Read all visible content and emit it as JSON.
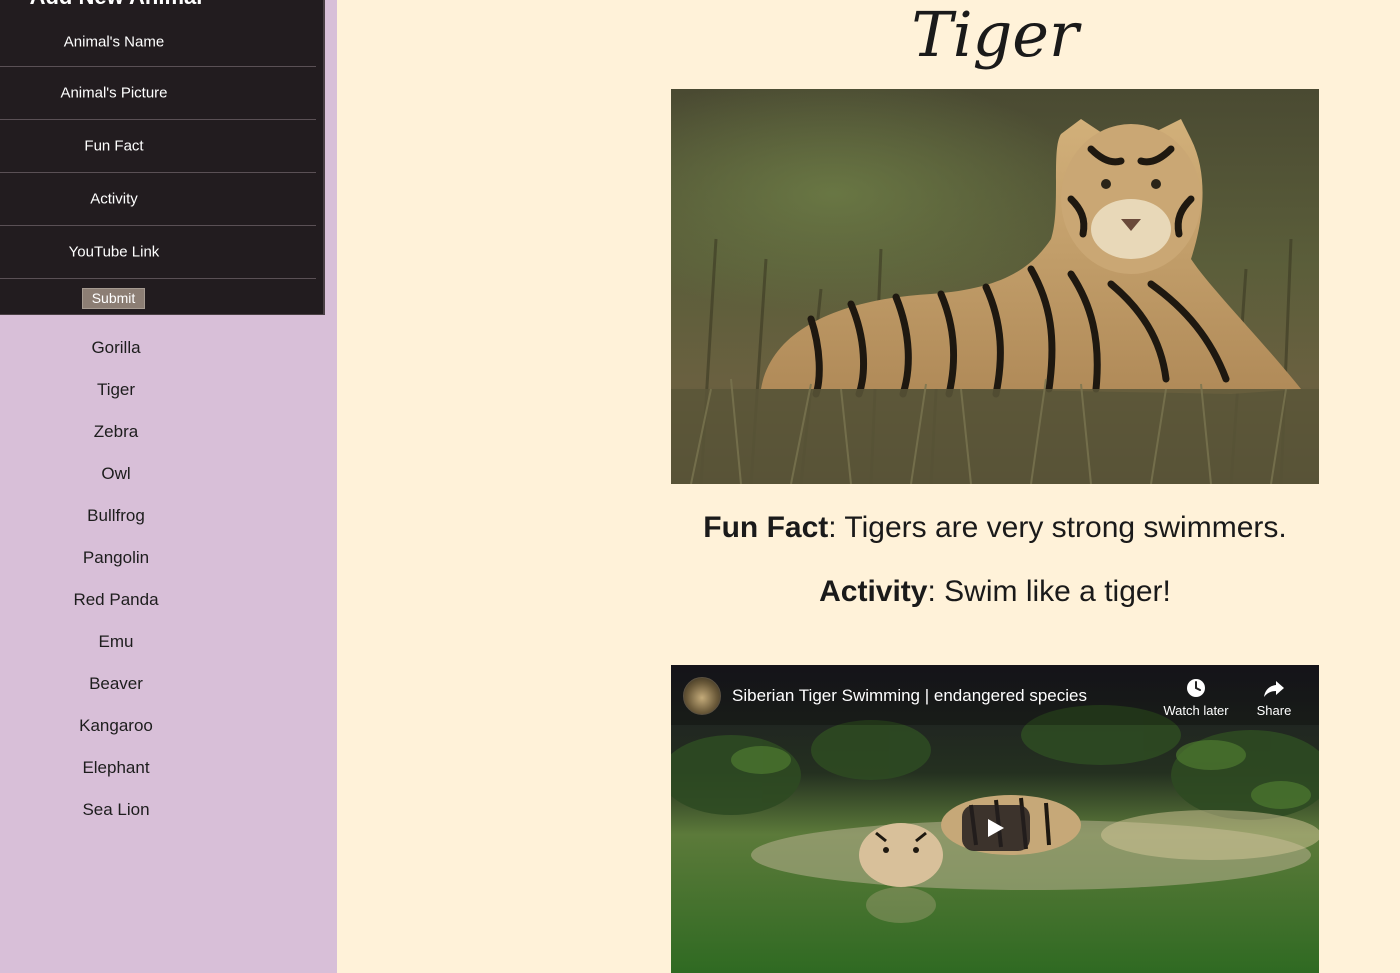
{
  "form": {
    "heading": "Add New Animal",
    "fields": [
      {
        "label": "Animal's Name"
      },
      {
        "label": "Animal's Picture"
      },
      {
        "label": "Fun Fact"
      },
      {
        "label": "Activity"
      },
      {
        "label": "YouTube Link"
      }
    ],
    "submit_label": "Submit"
  },
  "animals": [
    "Gorilla",
    "Tiger",
    "Zebra",
    "Owl",
    "Bullfrog",
    "Pangolin",
    "Red Panda",
    "Emu",
    "Beaver",
    "Kangaroo",
    "Elephant",
    "Sea Lion"
  ],
  "animal": {
    "name": "Tiger",
    "fun_fact_label": "Fun Fact",
    "fun_fact": "Tigers are very strong swimmers.",
    "activity_label": "Activity",
    "activity": "Swim like a tiger!"
  },
  "video": {
    "title": "Siberian Tiger Swimming | endangered species",
    "watch_later_label": "Watch later",
    "share_label": "Share"
  },
  "colors": {
    "page_background": "#fff2d9",
    "sidebar_background": "#d8bfd8",
    "form_background": "#221c1f"
  },
  "icons": {
    "watch_later": "clock-icon",
    "share": "share-arrow-icon",
    "play": "play-icon"
  }
}
